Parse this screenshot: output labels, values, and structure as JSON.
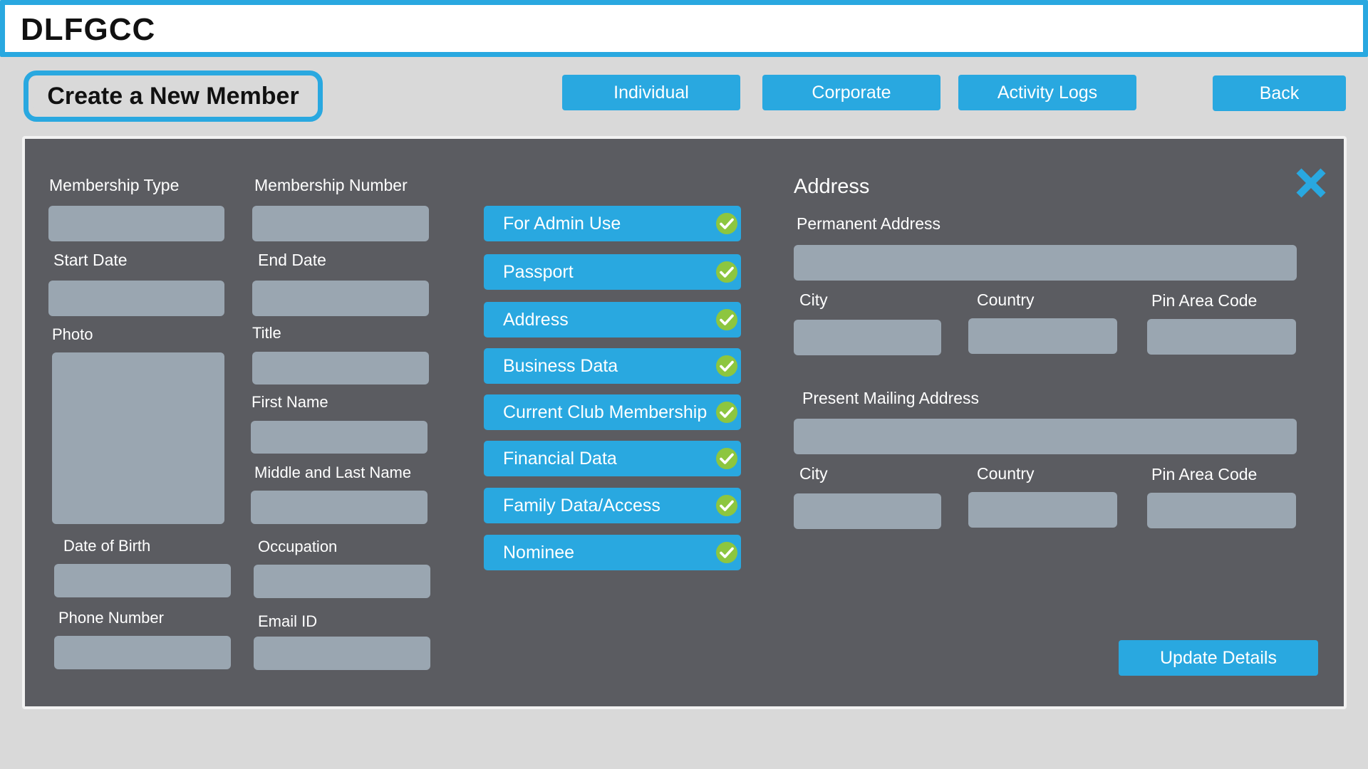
{
  "app": {
    "brand": "DLFGCC"
  },
  "header": {
    "page_title": "Create a New Member",
    "nav": {
      "individual": "Individual",
      "corporate": "Corporate",
      "activity_logs": "Activity Logs",
      "back": "Back"
    }
  },
  "form": {
    "labels": {
      "membership_type": "Membership Type",
      "membership_number": "Membership Number",
      "start_date": "Start Date",
      "end_date": "End Date",
      "photo": "Photo",
      "title": "Title",
      "first_name": "First Name",
      "middle_last_name": "Middle and Last Name",
      "date_of_birth": "Date of Birth",
      "occupation": "Occupation",
      "phone_number": "Phone Number",
      "email_id": "Email ID"
    },
    "values": {
      "membership_type": "",
      "membership_number": "",
      "start_date": "",
      "end_date": "",
      "title": "",
      "first_name": "",
      "middle_last_name": "",
      "date_of_birth": "",
      "occupation": "",
      "phone_number": "",
      "email_id": ""
    }
  },
  "sections": {
    "items": [
      {
        "label": "For Admin Use",
        "checked": true
      },
      {
        "label": "Passport",
        "checked": true
      },
      {
        "label": "Address",
        "checked": true
      },
      {
        "label": "Business Data",
        "checked": true
      },
      {
        "label": "Current Club Membership",
        "checked": true
      },
      {
        "label": "Financial Data",
        "checked": true
      },
      {
        "label": "Family Data/Access",
        "checked": true
      },
      {
        "label": "Nominee",
        "checked": true
      }
    ]
  },
  "address": {
    "heading": "Address",
    "permanent": {
      "label": "Permanent Address",
      "city_label": "City",
      "country_label": "Country",
      "pin_label": "Pin Area Code",
      "value": "",
      "city": "",
      "country": "",
      "pin": ""
    },
    "present": {
      "label": "Present Mailing Address",
      "city_label": "City",
      "country_label": "Country",
      "pin_label": "Pin Area Code",
      "value": "",
      "city": "",
      "country": "",
      "pin": ""
    }
  },
  "actions": {
    "update": "Update Details"
  },
  "colors": {
    "accent": "#29a8e0",
    "panel": "#5b5c61",
    "field": "#9aa6b1",
    "check": "#8dc63f",
    "background": "#d9d9d9"
  },
  "icons": {
    "close": "close-icon",
    "check": "check-icon"
  }
}
